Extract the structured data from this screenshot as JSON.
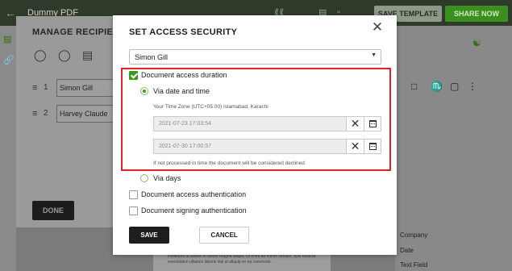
{
  "app": {
    "doc_title": "Dummy PDF",
    "save_template": "SAVE TEMPLATE",
    "share_now": "SHARE NOW"
  },
  "recipients_panel": {
    "heading": "MANAGE RECIPIENTS",
    "rows": [
      {
        "num": "1",
        "name": "Simon Gill"
      },
      {
        "num": "2",
        "name": "Harvey Claude"
      }
    ],
    "done_label": "DONE"
  },
  "fields_panel": {
    "items": [
      "Company",
      "Date",
      "Text Field"
    ]
  },
  "document": {
    "lorem": "Lorem ipsum dolor sit amet, consectetur adipiscing elit. Sed do eiusmod tempor incididunt ut labore et dolore magna aliqua. Ut enim ad minim veniam, quis nostrud exercitation ullamco laboris nisi ut aliquip ex ea commodo."
  },
  "modal": {
    "title": "SET ACCESS SECURITY",
    "recipient_select": "Simon Gill",
    "doc_access_duration": {
      "label": "Document access duration",
      "checked": true
    },
    "via_date_time": {
      "label": "Via date and time",
      "selected": true
    },
    "timezone": "Your Time Zone (UTC+05:00) Islamabad, Karachi",
    "start_datetime": "2021-07-23 17:03:54",
    "end_datetime": "2021-07-30 17:00:57",
    "note": "If not processed in time the document will be considered declined",
    "via_days": {
      "label": "Via days",
      "selected": false
    },
    "doc_access_auth": {
      "label": "Document access authentication",
      "checked": false
    },
    "doc_signing_auth": {
      "label": "Document signing authentication",
      "checked": false
    },
    "save_label": "SAVE",
    "cancel_label": "CANCEL"
  },
  "colors": {
    "accent": "#3b9a1e",
    "highlight_border": "#e02424"
  }
}
